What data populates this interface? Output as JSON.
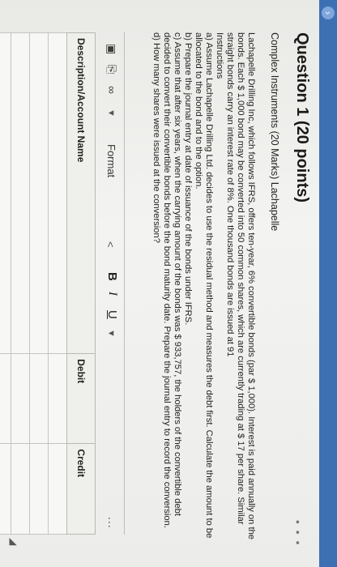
{
  "question": {
    "title": "Question 1 (20 points)",
    "subtitle": "Complex Instruments (20 Marks) Lachapelle",
    "paragraphs": [
      "Lachapelle Drilling Inc, which follows IFRS, offers ten-year, 6% convertible bonds (par $ 1,000). Interest is paid annually on the bonds. Each $ 1,000 bond may be converted into 50 common shares, which are currently trading at $ 17 per share. Similar straight bonds carry an interest rate of 8%. One thousand bonds are issued at 91",
      "Instructions",
      "a)        Assume Lachapelle Drilling Ltd. decides to use the residual method and measures the debt first. Calculate the amount to be allocated to the bond and to the option.",
      "b)        Prepare the journal entry at date of issuance of the bonds under IFRS.",
      "c)        Assume that after six years, when the carrying amount of the bonds was $ 933,757, the holders of the convertible debt decided to convert their convertible bonds before the bond maturity date.  Prepare the journal entry to record the conversion.",
      "d) How many shares were issued at the conversion?"
    ]
  },
  "toolbar": {
    "format_label": "Format",
    "bold_label": "B",
    "italic_label": "I",
    "underline_label": "U",
    "more_label": "..."
  },
  "table": {
    "headers": [
      "Description/Account Name",
      "Debit",
      "Credit"
    ],
    "rows": 5
  },
  "colors": {
    "topbar": "#3d6fb3"
  }
}
